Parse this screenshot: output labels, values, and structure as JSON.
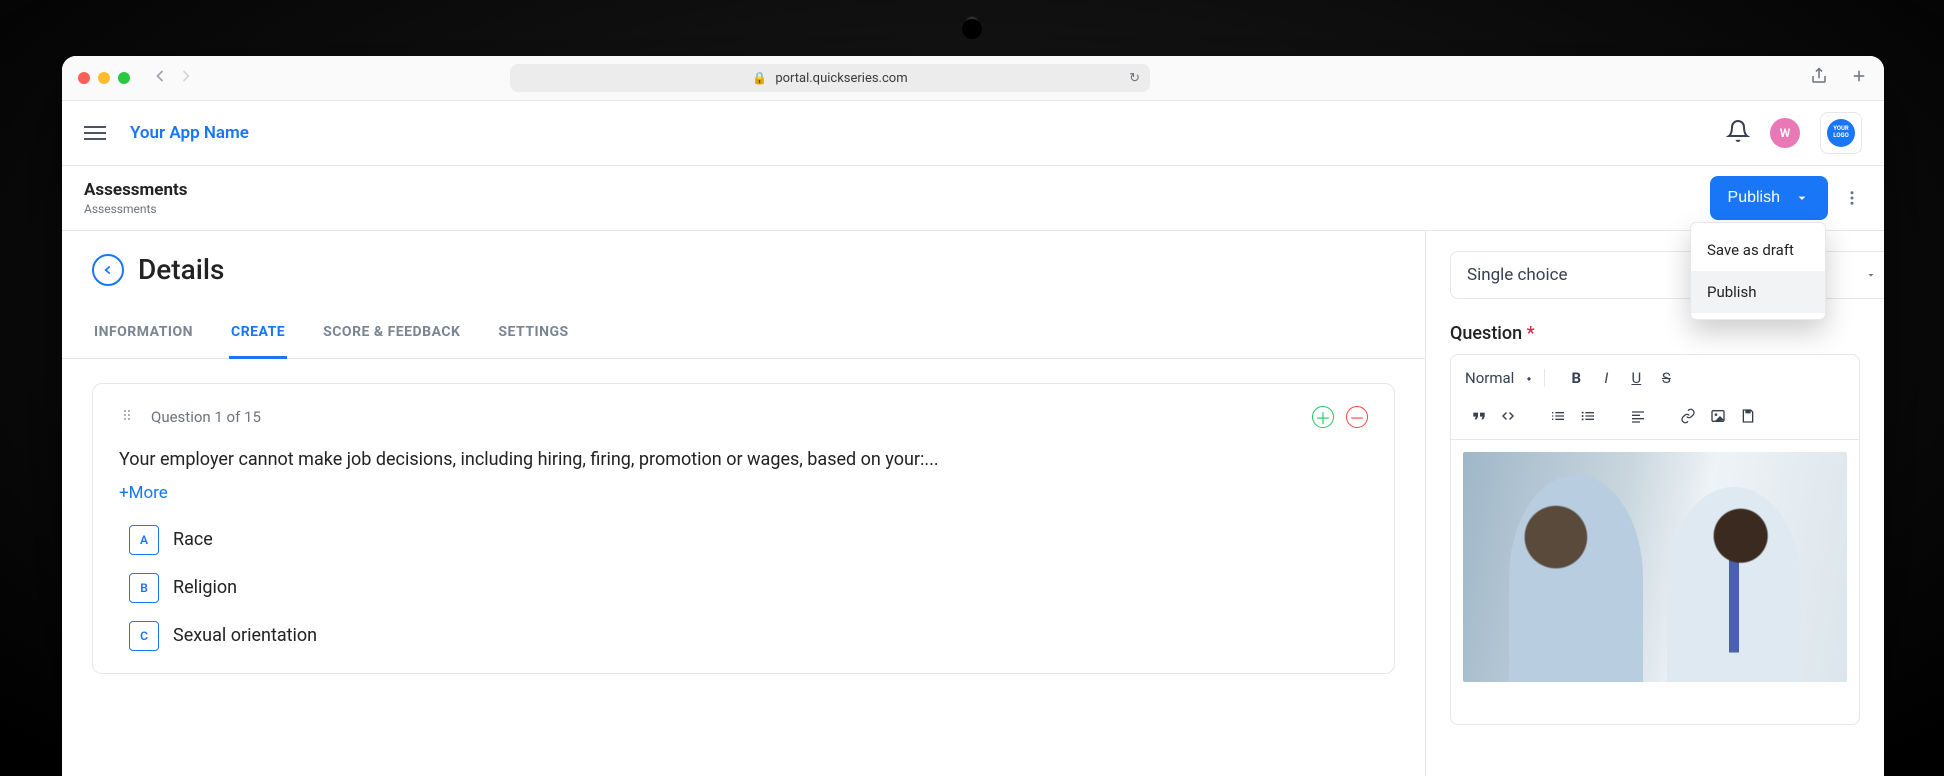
{
  "browser": {
    "url": "portal.quickseries.com"
  },
  "app": {
    "name_label": "Your App Name",
    "avatar_initial": "W",
    "logo_text": "YOUR LOGO"
  },
  "crumb": {
    "title": "Assessments",
    "subtitle": "Assessments",
    "publish_label": "Publish",
    "dropdown": {
      "save_draft": "Save as draft",
      "publish": "Publish"
    }
  },
  "details": {
    "title": "Details"
  },
  "tabs": {
    "information": "Information",
    "create": "Create",
    "score": "Score & Feedback",
    "settings": "Settings"
  },
  "question_card": {
    "counter": "Question 1 of 15",
    "text": "Your employer cannot make job decisions, including hiring, firing, promotion or wages, based on your:...",
    "more_label": "+More",
    "answers": [
      {
        "letter": "A",
        "label": "Race"
      },
      {
        "letter": "B",
        "label": "Religion"
      },
      {
        "letter": "C",
        "label": "Sexual orientation"
      }
    ]
  },
  "sidebar": {
    "type_select": "Single choice",
    "question_label": "Question",
    "toolbar": {
      "format": "Normal"
    }
  }
}
